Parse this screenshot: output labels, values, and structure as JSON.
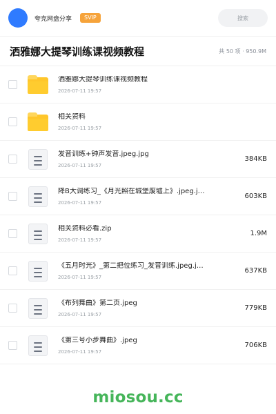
{
  "header": {
    "brand": "夸克网盘分享",
    "badge": "SVIP",
    "search_placeholder": "搜索"
  },
  "titlebar": {
    "title": "洒雅娜大提琴训练课视频教程",
    "meta": "共 50 项 · 950.9M"
  },
  "items": [
    {
      "type": "folder",
      "icon": "folder-icon",
      "name": "洒雅娜大提琴训练课视频教程",
      "date": "2026-07-11 19:57",
      "size": ""
    },
    {
      "type": "folder",
      "icon": "folder-icon",
      "name": "相关资料",
      "date": "2026-07-11 19:57",
      "size": ""
    },
    {
      "type": "file",
      "icon": "document-icon",
      "name": "发音训练+钟声发音.jpeg.jpg",
      "date": "2026-07-11 19:57",
      "size": "384KB"
    },
    {
      "type": "file",
      "icon": "document-icon",
      "name": "降B大调练习_《月光照在城堡废墟上》.jpeg.j…",
      "date": "2026-07-11 19:57",
      "size": "603KB"
    },
    {
      "type": "file",
      "icon": "document-icon",
      "name": "相关资料必看.zip",
      "date": "2026-07-11 19:57",
      "size": "1.9M"
    },
    {
      "type": "file",
      "icon": "document-icon",
      "name": "《五月时光》_第二把位练习_发音训练.jpeg.j…",
      "date": "2026-07-11 19:57",
      "size": "637KB"
    },
    {
      "type": "file",
      "icon": "document-icon",
      "name": "《布列舞曲》第二页.jpeg",
      "date": "2026-07-11 19:57",
      "size": "779KB"
    },
    {
      "type": "file",
      "icon": "document-icon",
      "name": "《第三号小步舞曲》.jpeg",
      "date": "2026-07-11 19:57",
      "size": "706KB"
    }
  ],
  "footer": {
    "watermark": "miosou.cc"
  },
  "colors": {
    "accent_blue": "#2f7bff",
    "svip_orange": "#f6a33a",
    "folder_yellow": "#ffc62b",
    "watermark_green": "#46b55a"
  }
}
